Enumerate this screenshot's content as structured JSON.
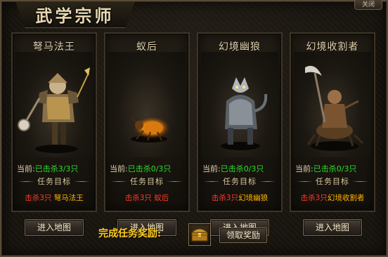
{
  "window": {
    "title": "武学宗师",
    "corner_tab": "关闭"
  },
  "progress_label": "当前:",
  "goal_label": "任务目标",
  "cards": [
    {
      "name": "弩马法王",
      "progress": "已击杀3/3只",
      "kill_prefix": "击杀3只",
      "target": "弩马法王",
      "button": "进入地图"
    },
    {
      "name": "蚁后",
      "progress": "已击杀0/3只",
      "kill_prefix": "击杀3只",
      "target": "蚁后",
      "button": "进入地图"
    },
    {
      "name": "幻境幽狼",
      "progress": "已击杀0/3只",
      "kill_prefix": "击杀3只",
      "target": "幻境幽狼",
      "button": "进入地图"
    },
    {
      "name": "幻境收割者",
      "progress": "已击杀0/3只",
      "kill_prefix": "击杀3只",
      "target": "幻境收割者",
      "button": "进入地图"
    }
  ],
  "reward": {
    "label": "完成任务奖励:",
    "item_icon": "treasure-chest-icon",
    "claim_button": "领取奖励"
  },
  "colors": {
    "progress_green": "#2dde2d",
    "kill_red": "#ff3a2a",
    "target_orange": "#ffb400",
    "reward_gold": "#ffcc22"
  }
}
